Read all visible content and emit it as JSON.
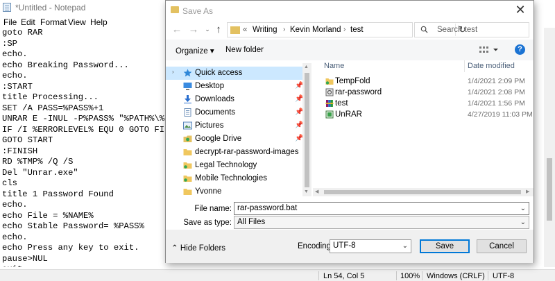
{
  "notepad": {
    "title": "*Untitled - Notepad",
    "menu": [
      "File",
      "Edit",
      "Format",
      "View",
      "Help"
    ],
    "lines": [
      "goto RAR",
      ":SP",
      "echo.",
      "echo Breaking Password...",
      "echo.",
      ":START",
      "title Processing...",
      "SET /A PASS=%PASS%+1",
      "UNRAR E -INUL -P%PASS% \"%PATH%\\%NAME%",
      "IF /I %ERRORLEVEL% EQU 0 GOTO FINISH",
      "GOTO START",
      ":FINISH",
      "RD %TMP% /Q /S",
      "Del \"Unrar.exe\"",
      "cls",
      "title 1 Password Found",
      "echo.",
      "echo File = %NAME%",
      "echo Stable Password= %PASS%",
      "echo.",
      "echo Press any key to exit.",
      "pause>NUL",
      "exit"
    ],
    "status": {
      "position": "Ln 54, Col 5",
      "zoom": "100%",
      "line_ending": "Windows (CRLF)",
      "encoding": "UTF-8"
    }
  },
  "dialog": {
    "title": "Save As",
    "close_glyph": "✕",
    "breadcrumb": [
      "Writing",
      "Kevin Morland",
      "test"
    ],
    "breadcrumb_prefix": "«",
    "search_placeholder": "Search test",
    "toolbar": {
      "organize": "Organize ▾",
      "new_folder": "New folder",
      "help": "?"
    },
    "nav_items": [
      {
        "label": "Quick access",
        "icon": "star-icon",
        "selected": true,
        "pinned": false
      },
      {
        "label": "Desktop",
        "icon": "desktop-icon",
        "selected": false,
        "pinned": true
      },
      {
        "label": "Downloads",
        "icon": "download-icon",
        "selected": false,
        "pinned": true
      },
      {
        "label": "Documents",
        "icon": "documents-icon",
        "selected": false,
        "pinned": true
      },
      {
        "label": "Pictures",
        "icon": "pictures-icon",
        "selected": false,
        "pinned": true
      },
      {
        "label": "Google Drive",
        "icon": "google-drive-icon",
        "selected": false,
        "pinned": true
      },
      {
        "label": "decrypt-rar-password-images",
        "icon": "folder-icon",
        "selected": false,
        "pinned": false
      },
      {
        "label": "Legal Technology",
        "icon": "shared-folder-icon",
        "selected": false,
        "pinned": false
      },
      {
        "label": "Mobile Technologies",
        "icon": "shared-folder-icon",
        "selected": false,
        "pinned": false
      },
      {
        "label": "Yvonne",
        "icon": "folder-icon",
        "selected": false,
        "pinned": false
      }
    ],
    "columns": {
      "name": "Name",
      "date": "Date modified"
    },
    "files": [
      {
        "name": "TempFold",
        "date": "1/4/2021 2:09 PM",
        "icon": "shared-folder-icon"
      },
      {
        "name": "rar-password",
        "date": "1/4/2021 2:08 PM",
        "icon": "batch-file-icon"
      },
      {
        "name": "test",
        "date": "1/4/2021 1:56 PM",
        "icon": "rar-archive-icon"
      },
      {
        "name": "UnRAR",
        "date": "4/27/2019 11:03 PM",
        "icon": "application-icon"
      }
    ],
    "file_name_label": "File name:",
    "file_name_value": "rar-password.bat",
    "save_type_label": "Save as type:",
    "save_type_value": "All Files",
    "hide_folders": "Hide Folders",
    "encoding_label": "Encoding:",
    "encoding_value": "UTF-8",
    "save": "Save",
    "cancel": "Cancel"
  }
}
